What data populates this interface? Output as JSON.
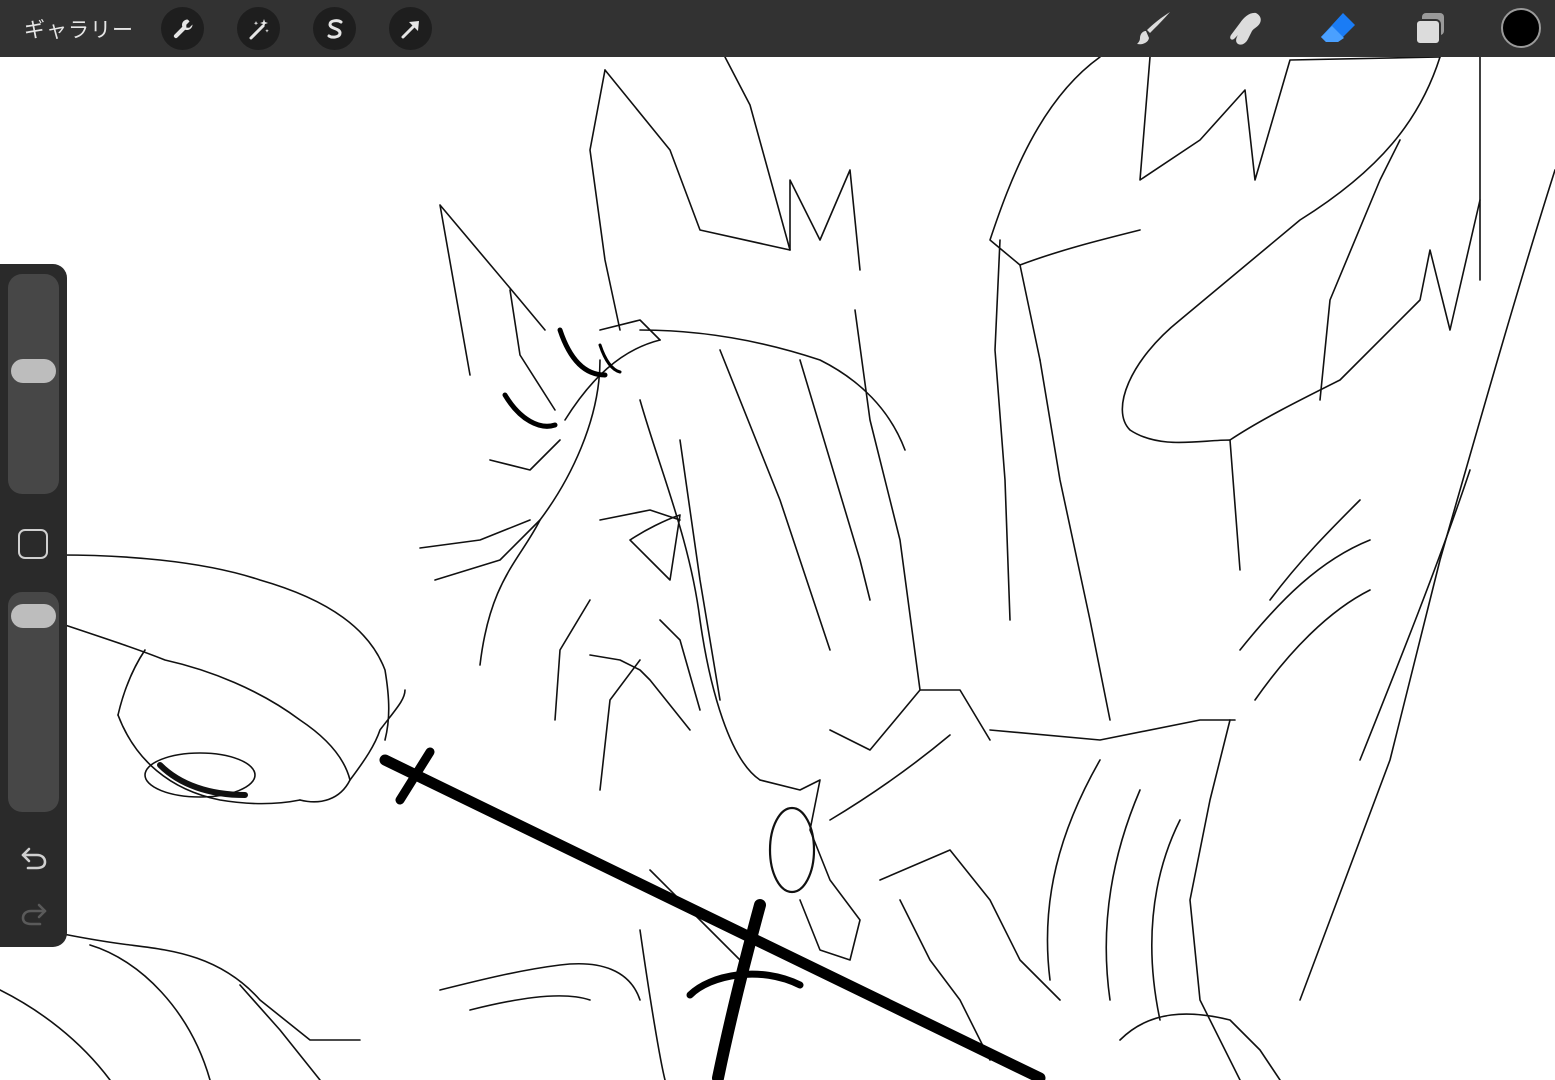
{
  "topbar": {
    "gallery_label": "ギャラリー",
    "left_tools": [
      {
        "name": "actions",
        "icon": "wrench-icon"
      },
      {
        "name": "adjustments",
        "icon": "magic-wand-icon"
      },
      {
        "name": "selection",
        "icon": "selection-s-icon"
      },
      {
        "name": "transform",
        "icon": "arrow-cursor-icon"
      }
    ],
    "right_tools": [
      {
        "name": "brush",
        "icon": "brush-icon",
        "active": false
      },
      {
        "name": "smudge",
        "icon": "smudge-icon",
        "active": false
      },
      {
        "name": "eraser",
        "icon": "eraser-icon",
        "active": true
      },
      {
        "name": "layers",
        "icon": "layers-icon",
        "active": false
      }
    ],
    "current_color": "#000000"
  },
  "colors": {
    "topbar_bg": "#323232",
    "active_tool": "#1a7cf5",
    "sidebar_bg": "#2a2a2a"
  },
  "sidebar": {
    "size_slider_level": 0.57,
    "opacity_slider_level": 0.96,
    "modifier_icon": "square-modifier-icon",
    "undo_icon": "undo-icon",
    "redo_icon": "redo-icon",
    "redo_enabled": false
  },
  "canvas": {
    "content": "line-art-drawing"
  }
}
